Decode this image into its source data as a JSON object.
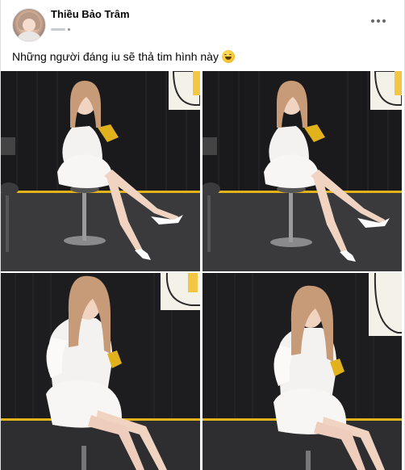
{
  "post": {
    "author_name": "Thiều Bảo Trâm",
    "caption_text": "Những người đáng iu sẽ thả tim hình này",
    "caption_emoji": "grinning-squinting-face-emoji",
    "photos": [
      {
        "name": "photo-1",
        "variant": "sitting-wide"
      },
      {
        "name": "photo-2",
        "variant": "sitting-wide"
      },
      {
        "name": "photo-3",
        "variant": "sitting-close"
      },
      {
        "name": "photo-4",
        "variant": "sitting-close"
      }
    ]
  },
  "colors": {
    "wall": "#1c1c1e",
    "yellow_stripe": "#e2b21c",
    "dress": "#f4f2f0",
    "hair": "#c89b78",
    "skin": "#f1d3c2",
    "frame_yellow": "#f2c744"
  }
}
